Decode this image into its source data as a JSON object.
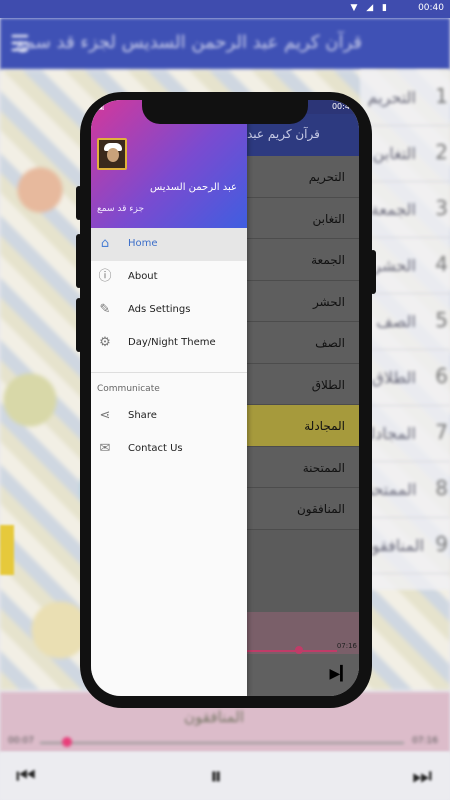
{
  "background": {
    "status_time": "00:40",
    "status_icons": "▼ ◢ ▮",
    "appbar_title": "قرآن كريم عبد الرحمن السديس لجزء قد سمع",
    "list": [
      {
        "num": "1",
        "name": "التحريم"
      },
      {
        "num": "2",
        "name": "التغابن"
      },
      {
        "num": "3",
        "name": "الجمعة"
      },
      {
        "num": "4",
        "name": "الحشر"
      },
      {
        "num": "5",
        "name": "الصف"
      },
      {
        "num": "6",
        "name": "الطلاق"
      },
      {
        "num": "7",
        "name": "المجادلة"
      },
      {
        "num": "8",
        "name": "الممتحنة"
      },
      {
        "num": "9",
        "name": "المنافقون"
      }
    ],
    "player_title": "المنافقون",
    "time_start": "00:07",
    "time_end": "07:16"
  },
  "app": {
    "status_time": "00:40",
    "title": "قرآن كريم عبد",
    "list": [
      "التحريم",
      "التغابن",
      "الجمعة",
      "الحشر",
      "الصف",
      "الطلاق",
      "المجادلة",
      "الممتحنة",
      "المنافقون"
    ],
    "active_index": 6,
    "player_time": "07:16",
    "next_icon": "▶▎"
  },
  "drawer": {
    "status_icon": "▣",
    "header_name": "عبد الرحمن السديس",
    "header_sub": "جزء قد سمع",
    "items": [
      {
        "label": "Home",
        "icon": "⌂",
        "selected": true
      },
      {
        "label": "About",
        "icon": "ⓘ"
      },
      {
        "label": "Ads Settings",
        "icon": "✎"
      },
      {
        "label": "Day/Night Theme",
        "icon": "⚙"
      }
    ],
    "section_title": "Communicate",
    "communicate_items": [
      {
        "label": "Share",
        "icon": "⋖"
      },
      {
        "label": "Contact Us",
        "icon": "✉"
      }
    ]
  }
}
